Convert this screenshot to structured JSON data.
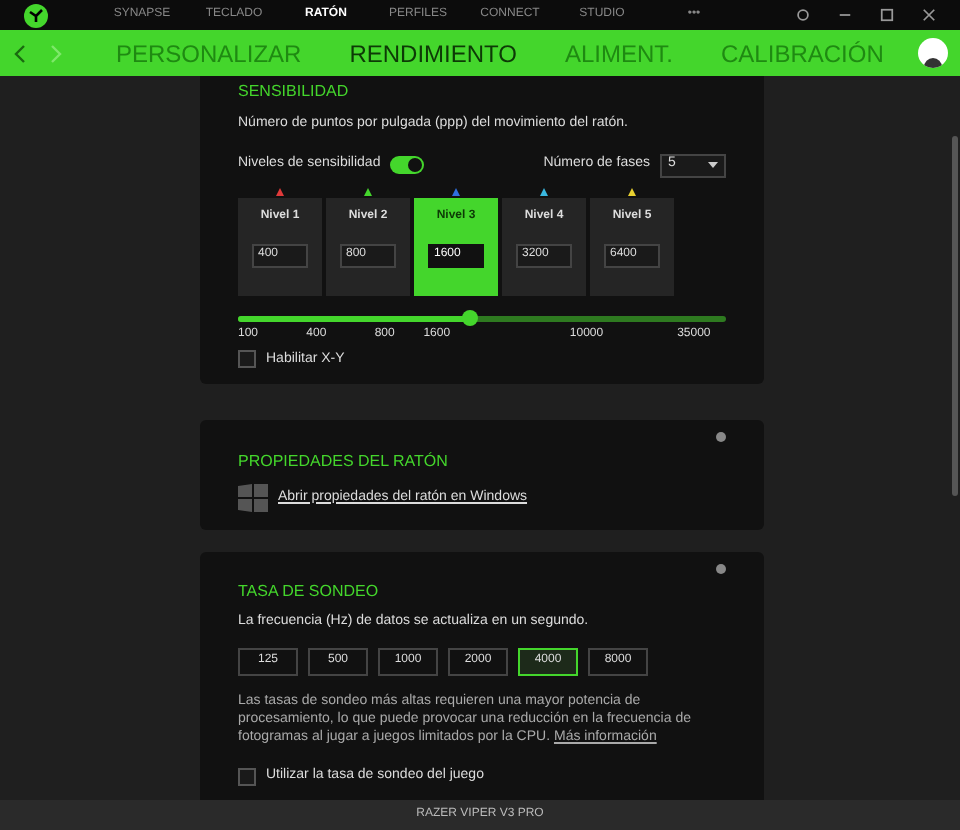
{
  "top_nav": {
    "items": [
      {
        "label": "SYNAPSE",
        "selected": false
      },
      {
        "label": "TECLADO",
        "selected": false
      },
      {
        "label": "RATÓN",
        "selected": true
      },
      {
        "label": "PERFILES",
        "selected": false
      },
      {
        "label": "CONNECT",
        "selected": false
      },
      {
        "label": "STUDIO",
        "selected": false
      },
      {
        "label": "•••",
        "selected": false
      }
    ]
  },
  "sub_nav": {
    "tabs": [
      {
        "label": "PERSONALIZAR",
        "selected": false
      },
      {
        "label": "RENDIMIENTO",
        "selected": true
      },
      {
        "label": "ALIMENT.",
        "selected": false
      },
      {
        "label": "CALIBRACIÓN",
        "selected": false
      }
    ]
  },
  "sensitivity": {
    "title": "SENSIBILIDAD",
    "description": "Número de puntos por pulgada (ppp) del movimiento del ratón.",
    "levels_label": "Niveles de sensibilidad",
    "levels_on": true,
    "stages_label": "Número de fases",
    "stages_value": "5",
    "levels": [
      {
        "label": "Nivel 1",
        "value": "400",
        "color": "#e03a3a",
        "selected": false
      },
      {
        "label": "Nivel 2",
        "value": "800",
        "color": "#44d62c",
        "selected": false
      },
      {
        "label": "Nivel 3",
        "value": "1600",
        "color": "#2f6fe0",
        "selected": true
      },
      {
        "label": "Nivel 4",
        "value": "3200",
        "color": "#3ab8e0",
        "selected": false
      },
      {
        "label": "Nivel 5",
        "value": "6400",
        "color": "#e8d030",
        "selected": false
      }
    ],
    "slider": {
      "level": 0.476,
      "ticks": [
        "100",
        "400",
        "800",
        "1600",
        "10000",
        "35000"
      ]
    },
    "xy_label": "Habilitar X-Y",
    "xy_checked": false
  },
  "mouse_properties": {
    "title": "PROPIEDADES DEL RATÓN",
    "link": "Abrir propiedades del ratón en Windows"
  },
  "polling": {
    "title": "TASA DE SONDEO",
    "description": "La frecuencia (Hz) de datos se actualiza en un segundo.",
    "rates": [
      {
        "label": "125",
        "selected": false
      },
      {
        "label": "500",
        "selected": false
      },
      {
        "label": "1000",
        "selected": false
      },
      {
        "label": "2000",
        "selected": false
      },
      {
        "label": "4000",
        "selected": true
      },
      {
        "label": "8000",
        "selected": false
      }
    ],
    "note": "Las tasas de sondeo más altas requieren una mayor potencia de procesamiento, lo que puede provocar una reducción en la frecuencia de fotogramas al jugar a juegos limitados por la CPU.",
    "note_link": "Más información",
    "game_rate_label": "Utilizar la tasa de sondeo del juego",
    "game_rate_checked": false
  },
  "footer": {
    "device": "RAZER VIPER V3 PRO"
  }
}
